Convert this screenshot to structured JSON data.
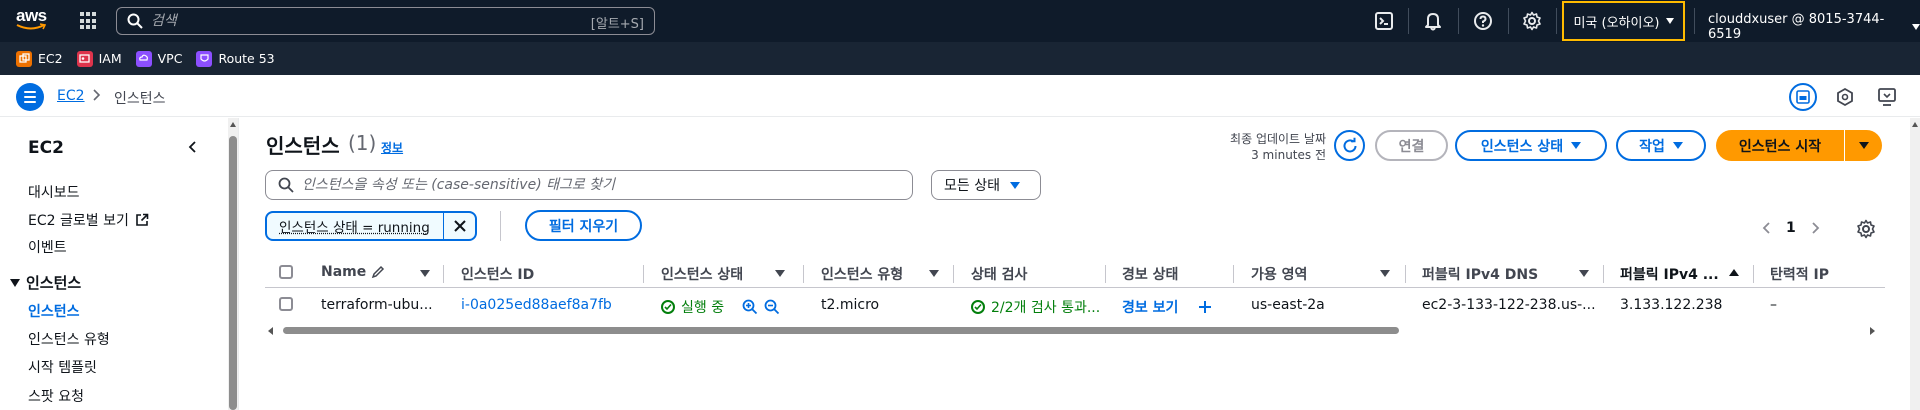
{
  "topnav": {
    "logo_text": "aws",
    "search_placeholder": "검색",
    "search_shortcut": "[알트+S]",
    "region": "미국 (오하이오)",
    "account": "clouddxuser @ 8015-3744-6519"
  },
  "favorites": [
    {
      "label": "EC2",
      "color": "#ed7100"
    },
    {
      "label": "IAM",
      "color": "#dd344c"
    },
    {
      "label": "VPC",
      "color": "#8c4fff"
    },
    {
      "label": "Route 53",
      "color": "#8c4fff"
    }
  ],
  "breadcrumb": {
    "parent": "EC2",
    "current": "인스턴스"
  },
  "sidenav": {
    "title": "EC2",
    "items": [
      "대시보드",
      "EC2 글로벌 보기",
      "이벤트"
    ],
    "section": "인스턴스",
    "section_items": [
      "인스턴스",
      "인스턴스 유형",
      "시작 템플릿",
      "스팟 요청"
    ]
  },
  "main": {
    "title": "인스턴스",
    "count": "(1)",
    "info": "정보",
    "last_updated_label": "최종 업데이트 날짜",
    "last_updated_value": "3 minutes 전",
    "connect_btn": "연결",
    "state_btn": "인스턴스 상태",
    "actions_btn": "작업",
    "launch_btn": "인스턴스 시작",
    "filter_placeholder": "인스턴스을 속성 또는 (case-sensitive) 태그로 찾기",
    "state_filter": "모든 상태",
    "token": "인스턴스 상태 = running",
    "clear_filters": "필터 지우기",
    "page": "1"
  },
  "table": {
    "headers": [
      "Name",
      "인스턴스 ID",
      "인스턴스 상태",
      "인스턴스 유형",
      "상태 검사",
      "경보 상태",
      "가용 영역",
      "퍼블릭 IPv4 DNS",
      "퍼블릭 IPv4 ...",
      "탄력적 IP"
    ],
    "row": {
      "name": "terraform-ubu...",
      "instance_id": "i-0a025ed88aef8a7fb",
      "state": "실행 중",
      "type": "t2.micro",
      "status_check": "2/2개 검사 통과...",
      "alarm": "경보 보기",
      "az": "us-east-2a",
      "dns": "ec2-3-133-122-238.us-...",
      "ip": "3.133.122.238",
      "eip": "–"
    }
  },
  "colors": {
    "nav_bg": "#0f1b2a",
    "accent": "#006ce0",
    "primary": "#ff9900",
    "success": "#037f0c",
    "region_highlight": "#ffbb00"
  }
}
